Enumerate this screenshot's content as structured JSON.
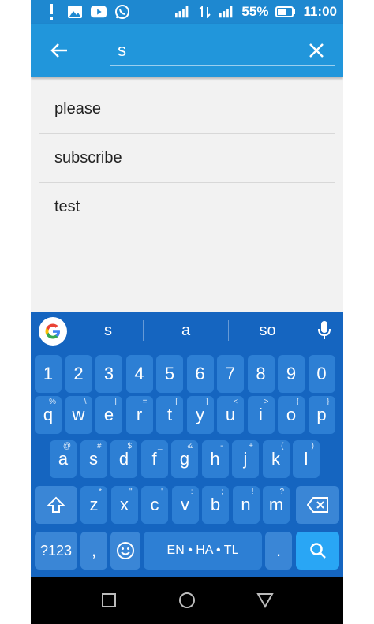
{
  "status_bar": {
    "battery": "55%",
    "time": "11:00",
    "left_icons": [
      "alert-icon",
      "gallery-icon",
      "youtube-icon",
      "whatsapp-icon"
    ],
    "right_icons": [
      "signal-icon",
      "data-icon",
      "signal-2-icon",
      "battery-icon"
    ]
  },
  "toolbar": {
    "search_value": "s",
    "color": "#2196db"
  },
  "suggestions": [
    {
      "label": "please"
    },
    {
      "label": "subscribe"
    },
    {
      "label": "test"
    }
  ],
  "keyboard": {
    "strip": {
      "s1": "s",
      "s2": "a",
      "s3": "so"
    },
    "numbers": [
      "1",
      "2",
      "3",
      "4",
      "5",
      "6",
      "7",
      "8",
      "9",
      "0"
    ],
    "row1": [
      {
        "k": "q",
        "h": "%"
      },
      {
        "k": "w",
        "h": "\\"
      },
      {
        "k": "e",
        "h": "|"
      },
      {
        "k": "r",
        "h": "="
      },
      {
        "k": "t",
        "h": "["
      },
      {
        "k": "y",
        "h": "]"
      },
      {
        "k": "u",
        "h": "<"
      },
      {
        "k": "i",
        "h": ">"
      },
      {
        "k": "o",
        "h": "{"
      },
      {
        "k": "p",
        "h": "}"
      }
    ],
    "row2": [
      {
        "k": "a",
        "h": "@"
      },
      {
        "k": "s",
        "h": "#"
      },
      {
        "k": "d",
        "h": "$"
      },
      {
        "k": "f",
        "h": "_"
      },
      {
        "k": "g",
        "h": "&"
      },
      {
        "k": "h",
        "h": "-"
      },
      {
        "k": "j",
        "h": "+"
      },
      {
        "k": "k",
        "h": "("
      },
      {
        "k": "l",
        "h": ")"
      }
    ],
    "row3": [
      {
        "k": "z",
        "h": "*"
      },
      {
        "k": "x",
        "h": "\""
      },
      {
        "k": "c",
        "h": "'"
      },
      {
        "k": "v",
        "h": ":"
      },
      {
        "k": "b",
        "h": ";"
      },
      {
        "k": "n",
        "h": "!"
      },
      {
        "k": "m",
        "h": "?"
      }
    ],
    "sym_label": "?123",
    "comma": ",",
    "space_label": "EN • HA • TL",
    "period": ".",
    "accent_color": "#1565c0"
  }
}
